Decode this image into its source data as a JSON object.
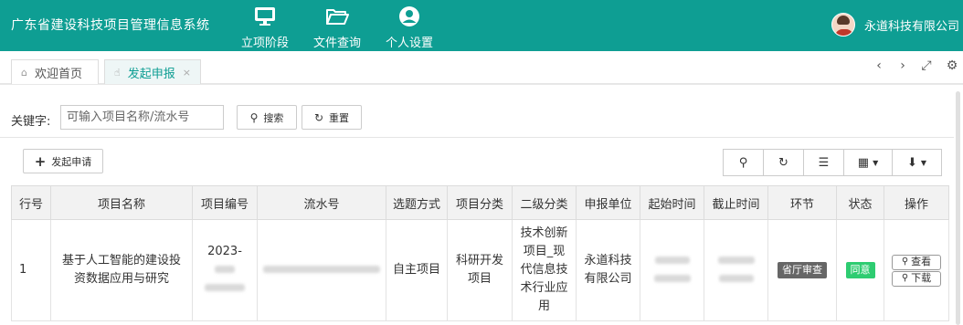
{
  "app": {
    "title": "广东省建设科技项目管理信息系统"
  },
  "nav": [
    {
      "label": "立项阶段",
      "icon": "monitor-icon"
    },
    {
      "label": "文件查询",
      "icon": "folder-open-icon"
    },
    {
      "label": "个人设置",
      "icon": "user-circle-icon"
    }
  ],
  "user": {
    "name": "永道科技有限公司"
  },
  "tabs": [
    {
      "label": "欢迎首页",
      "icon": "home-icon"
    },
    {
      "label": "发起申报",
      "icon": "cursor-icon",
      "close": "×"
    }
  ],
  "tab_controls": [
    "‹",
    "›",
    "⤢",
    "⚙"
  ],
  "filter": {
    "label": "关键字:",
    "placeholder": "可输入项目名称/流水号",
    "search_label": "搜索",
    "reset_label": "重置"
  },
  "toolbar": {
    "create_label": "发起申请"
  },
  "table": {
    "headers": [
      "行号",
      "项目名称",
      "项目编号",
      "流水号",
      "选题方式",
      "项目分类",
      "二级分类",
      "申报单位",
      "起始时间",
      "截止时间",
      "环节",
      "状态",
      "操作"
    ],
    "rows": [
      {
        "index": "1",
        "name": "基于人工智能的建设投资数据应用与研究",
        "code": "2023-",
        "topic_mode": "自主项目",
        "category": "科研开发项目",
        "subcategory": "技术创新项目_现代信息技术行业应用",
        "unit": "永道科技有限公司",
        "stage": "省厅审查",
        "status": "同意",
        "actions": [
          "查看",
          "下载"
        ]
      }
    ]
  },
  "colors": {
    "primary": "#0e9e93",
    "stage_badge": "#666666",
    "status_badge": "#2ecc71"
  }
}
